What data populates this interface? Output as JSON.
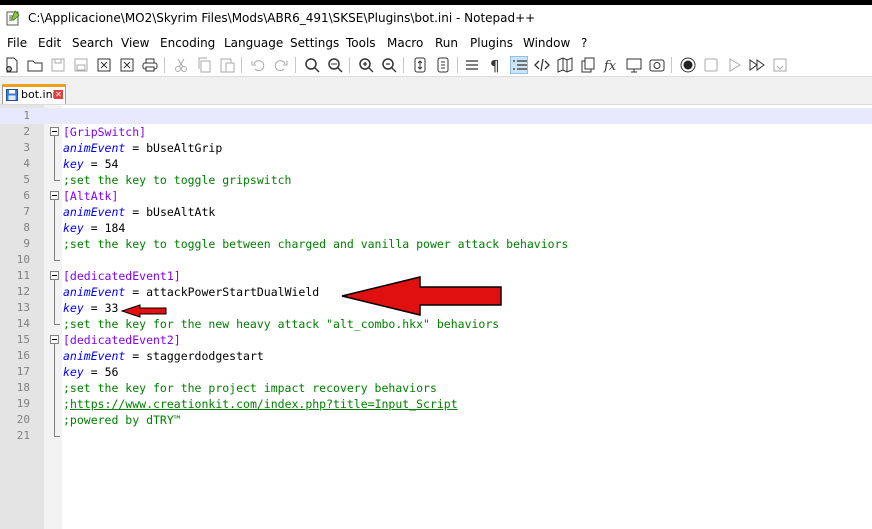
{
  "window": {
    "title": "C:\\Applicacione\\MO2\\Skyrim Files\\Mods\\ABR6_491\\SKSE\\Plugins\\bot.ini - Notepad++"
  },
  "menu": [
    "File",
    "Edit",
    "Search",
    "View",
    "Encoding",
    "Language",
    "Settings",
    "Tools",
    "Macro",
    "Run",
    "Plugins",
    "Window",
    "?"
  ],
  "toolbar": {
    "icons": [
      "new-file-icon",
      "open-file-icon",
      "save-icon",
      "save-all-icon",
      "close-icon",
      "close-all-icon",
      "print-icon",
      "cut-icon",
      "copy-icon",
      "paste-icon",
      "undo-icon",
      "redo-icon",
      "find-icon",
      "replace-icon",
      "zoom-in-icon",
      "zoom-out-icon",
      "sync-scroll-icon",
      "word-wrap-icon",
      "show-all-chars-icon",
      "indent-guide-icon",
      "xml-tag-icon",
      "document-map-icon",
      "clipboard-history-icon",
      "function-list-icon",
      "monitor-icon",
      "screenshot-icon",
      "record-macro-icon",
      "stop-macro-icon",
      "play-macro-icon",
      "run-multiple-macro-icon",
      "save-macro-icon"
    ]
  },
  "tabs": [
    {
      "label": "bot.ini"
    }
  ],
  "editor": {
    "current_line": 1,
    "lines": [
      {
        "n": "1",
        "text": ""
      },
      {
        "n": "2",
        "section": "[GripSwitch]"
      },
      {
        "n": "3",
        "key": "animEvent",
        "value": "bUseAltGrip"
      },
      {
        "n": "4",
        "key": "key",
        "value": "54"
      },
      {
        "n": "5",
        "comment": ";set the key to toggle gripswitch"
      },
      {
        "n": "6",
        "section": "[AltAtk]"
      },
      {
        "n": "7",
        "key": "animEvent",
        "value": "bUseAltAtk"
      },
      {
        "n": "8",
        "key": "key",
        "value": "184"
      },
      {
        "n": "9",
        "comment": ";set the key to toggle between charged and vanilla power attack behaviors"
      },
      {
        "n": "10",
        "text": ""
      },
      {
        "n": "11",
        "section": "[dedicatedEvent1]"
      },
      {
        "n": "12",
        "key": "animEvent",
        "value": "attackPowerStartDualWield"
      },
      {
        "n": "13",
        "key": "key",
        "value": "33"
      },
      {
        "n": "14",
        "comment": ";set the key for the new heavy attack \"alt_combo.hkx\" behaviors"
      },
      {
        "n": "15",
        "section": "[dedicatedEvent2]"
      },
      {
        "n": "16",
        "key": "animEvent",
        "value": "staggerdodgestart"
      },
      {
        "n": "17",
        "key": "key",
        "value": "56"
      },
      {
        "n": "18",
        "comment": ";set the key for the project impact recovery behaviors"
      },
      {
        "n": "19",
        "link_prefix": ";",
        "link": "https://www.creationkit.com/index.php?title=Input_Script"
      },
      {
        "n": "20",
        "comment": ";powered by dTRY™"
      },
      {
        "n": "21",
        "text": ""
      }
    ]
  },
  "annotations": {
    "arrow_color": "#e01010"
  }
}
